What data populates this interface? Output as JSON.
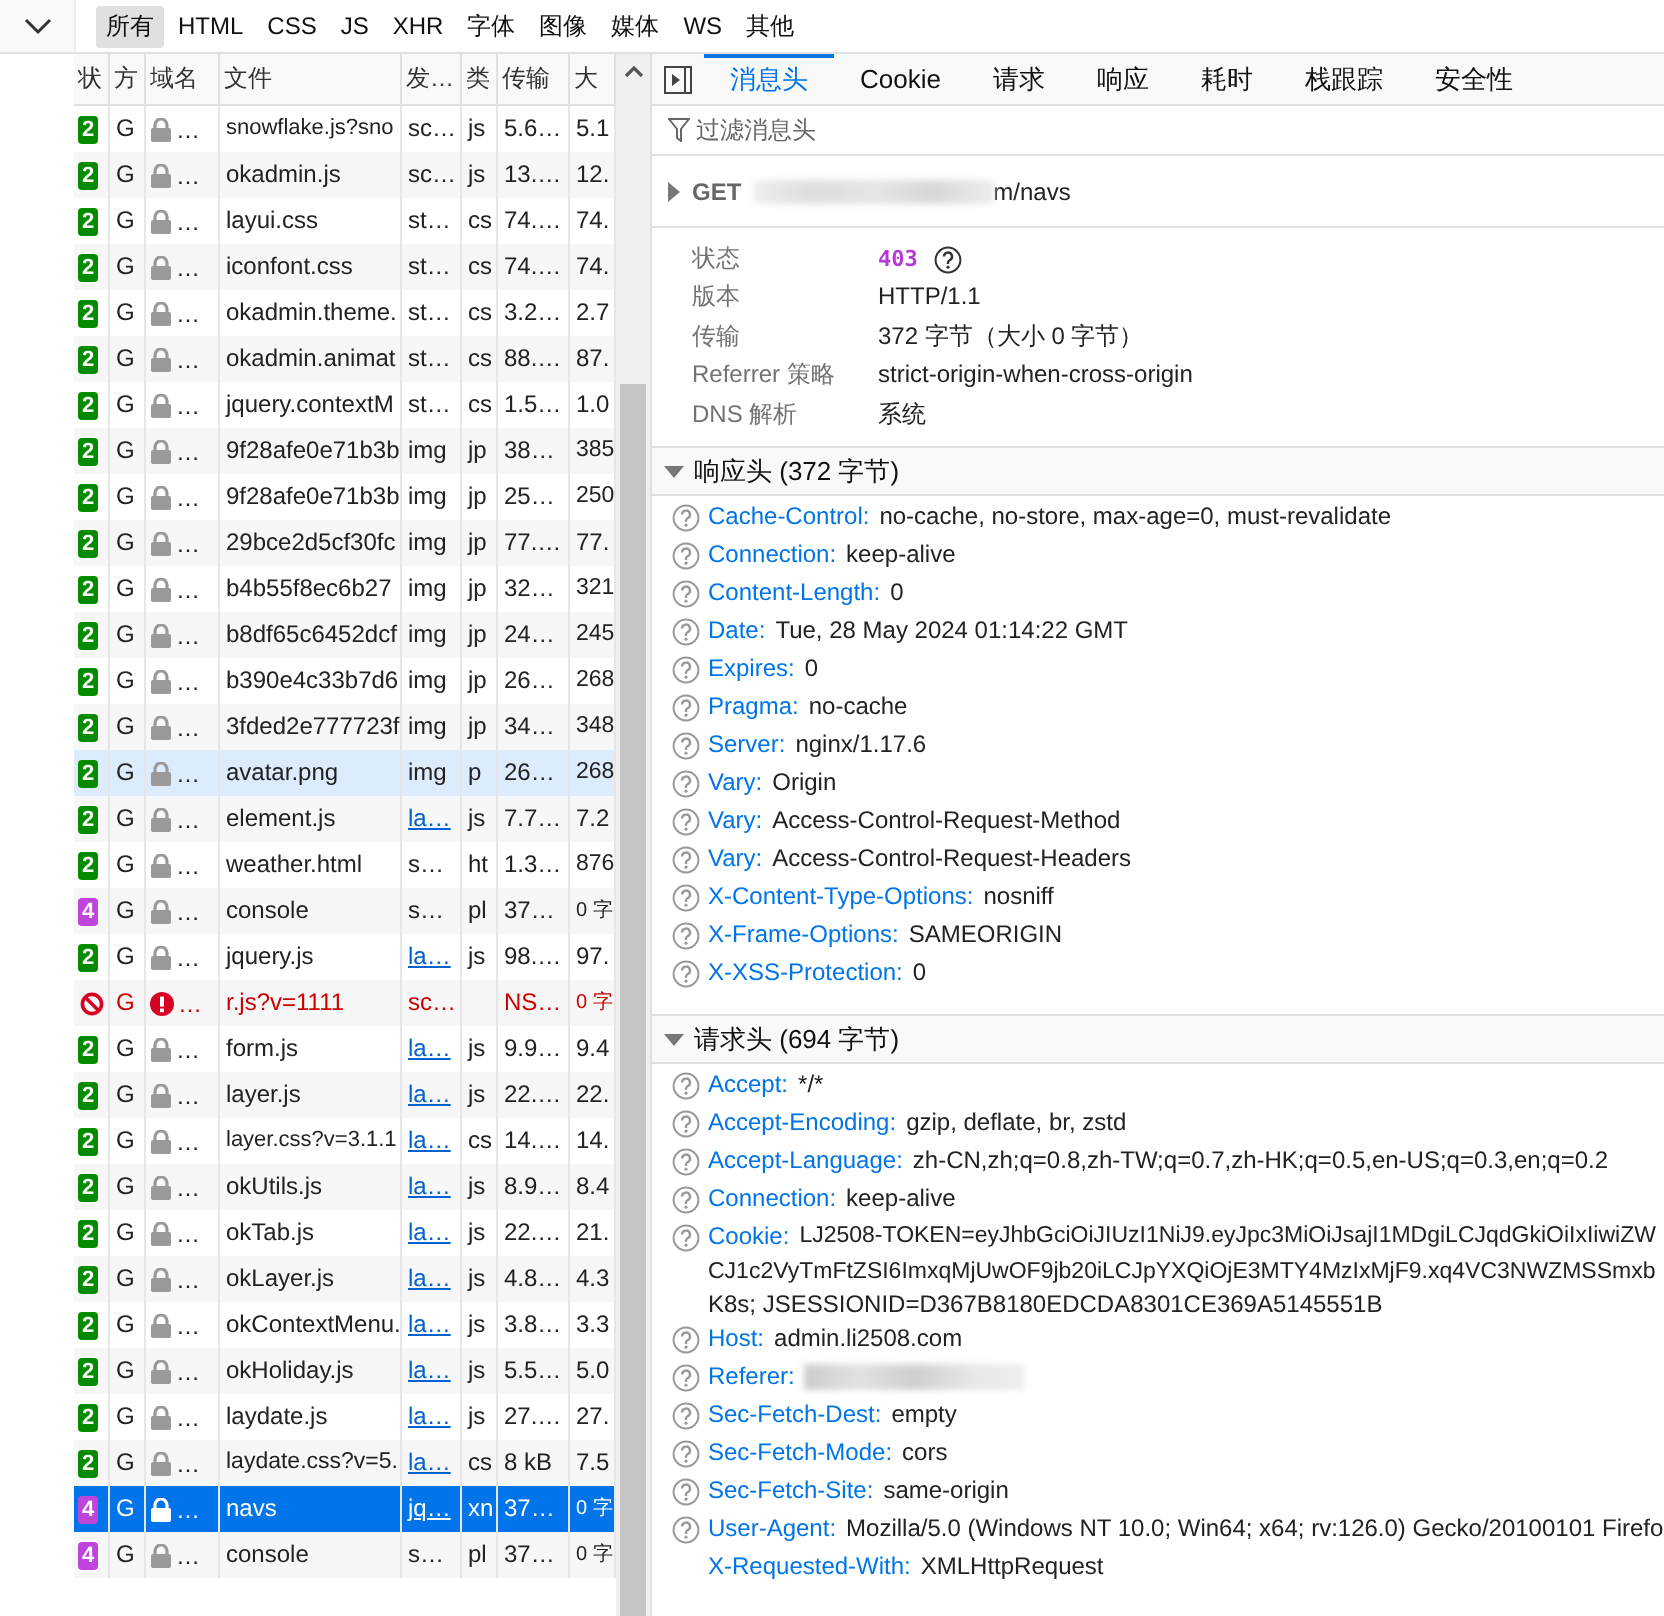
{
  "toolbar": {
    "filters": [
      {
        "label": "所有",
        "selected": true
      },
      {
        "label": "HTML",
        "selected": false
      },
      {
        "label": "CSS",
        "selected": false
      },
      {
        "label": "JS",
        "selected": false
      },
      {
        "label": "XHR",
        "selected": false
      },
      {
        "label": "字体",
        "selected": false
      },
      {
        "label": "图像",
        "selected": false
      },
      {
        "label": "媒体",
        "selected": false
      },
      {
        "label": "WS",
        "selected": false
      },
      {
        "label": "其他",
        "selected": false
      }
    ]
  },
  "table": {
    "columns": [
      "状",
      "方",
      "域名",
      "文件",
      "发…",
      "类",
      "传输",
      "大"
    ],
    "rows": [
      {
        "kind": "ok",
        "status": "2",
        "color": "#058b00",
        "method": "G",
        "domain": "…",
        "file": "snowflake.js?sno",
        "initiator": "sc…",
        "initiator_link": false,
        "type": "js",
        "transfer": "5.6…",
        "size": "5.1",
        "selected": false,
        "hovered": false
      },
      {
        "kind": "ok",
        "status": "2",
        "color": "#058b00",
        "method": "G",
        "domain": "…",
        "file": "okadmin.js",
        "initiator": "sc…",
        "initiator_link": false,
        "type": "js",
        "transfer": "13.…",
        "size": "12.",
        "selected": false,
        "hovered": false
      },
      {
        "kind": "ok",
        "status": "2",
        "color": "#058b00",
        "method": "G",
        "domain": "…",
        "file": "layui.css",
        "initiator": "st…",
        "initiator_link": false,
        "type": "cs",
        "transfer": "74.…",
        "size": "74.",
        "selected": false,
        "hovered": false
      },
      {
        "kind": "ok",
        "status": "2",
        "color": "#058b00",
        "method": "G",
        "domain": "…",
        "file": "iconfont.css",
        "initiator": "st…",
        "initiator_link": false,
        "type": "cs",
        "transfer": "74.…",
        "size": "74.",
        "selected": false,
        "hovered": false
      },
      {
        "kind": "ok",
        "status": "2",
        "color": "#058b00",
        "method": "G",
        "domain": "…",
        "file": "okadmin.theme.",
        "initiator": "st…",
        "initiator_link": false,
        "type": "cs",
        "transfer": "3.2…",
        "size": "2.7",
        "selected": false,
        "hovered": false
      },
      {
        "kind": "ok",
        "status": "2",
        "color": "#058b00",
        "method": "G",
        "domain": "…",
        "file": "okadmin.animat",
        "initiator": "st…",
        "initiator_link": false,
        "type": "cs",
        "transfer": "88.…",
        "size": "87.",
        "selected": false,
        "hovered": false
      },
      {
        "kind": "ok",
        "status": "2",
        "color": "#058b00",
        "method": "G",
        "domain": "…",
        "file": "jquery.contextM",
        "initiator": "st…",
        "initiator_link": false,
        "type": "cs",
        "transfer": "1.5…",
        "size": "1.0",
        "selected": false,
        "hovered": false
      },
      {
        "kind": "ok",
        "status": "2",
        "color": "#058b00",
        "method": "G",
        "domain": "…",
        "file": "9f28afe0e71b3b",
        "initiator": "img",
        "initiator_link": false,
        "type": "jp",
        "transfer": "38…",
        "size": "385",
        "selected": false,
        "hovered": false
      },
      {
        "kind": "ok",
        "status": "2",
        "color": "#058b00",
        "method": "G",
        "domain": "…",
        "file": "9f28afe0e71b3b",
        "initiator": "img",
        "initiator_link": false,
        "type": "jp",
        "transfer": "25…",
        "size": "250",
        "selected": false,
        "hovered": false
      },
      {
        "kind": "ok",
        "status": "2",
        "color": "#058b00",
        "method": "G",
        "domain": "…",
        "file": "29bce2d5cf30fc",
        "initiator": "img",
        "initiator_link": false,
        "type": "jp",
        "transfer": "77.…",
        "size": "77.",
        "selected": false,
        "hovered": false
      },
      {
        "kind": "ok",
        "status": "2",
        "color": "#058b00",
        "method": "G",
        "domain": "…",
        "file": "b4b55f8ec6b27",
        "initiator": "img",
        "initiator_link": false,
        "type": "jp",
        "transfer": "32…",
        "size": "321",
        "selected": false,
        "hovered": false
      },
      {
        "kind": "ok",
        "status": "2",
        "color": "#058b00",
        "method": "G",
        "domain": "…",
        "file": "b8df65c6452dcf",
        "initiator": "img",
        "initiator_link": false,
        "type": "jp",
        "transfer": "24…",
        "size": "245",
        "selected": false,
        "hovered": false
      },
      {
        "kind": "ok",
        "status": "2",
        "color": "#058b00",
        "method": "G",
        "domain": "…",
        "file": "b390e4c33b7d6",
        "initiator": "img",
        "initiator_link": false,
        "type": "jp",
        "transfer": "26…",
        "size": "268",
        "selected": false,
        "hovered": false
      },
      {
        "kind": "ok",
        "status": "2",
        "color": "#058b00",
        "method": "G",
        "domain": "…",
        "file": "3fded2e777723f",
        "initiator": "img",
        "initiator_link": false,
        "type": "jp",
        "transfer": "34…",
        "size": "348",
        "selected": false,
        "hovered": false
      },
      {
        "kind": "ok",
        "status": "2",
        "color": "#058b00",
        "method": "G",
        "domain": "…",
        "file": "avatar.png",
        "initiator": "img",
        "initiator_link": false,
        "type": "p",
        "transfer": "26…",
        "size": "268",
        "selected": false,
        "hovered": true
      },
      {
        "kind": "ok",
        "status": "2",
        "color": "#058b00",
        "method": "G",
        "domain": "…",
        "file": "element.js",
        "initiator": "la…",
        "initiator_link": true,
        "type": "js",
        "transfer": "7.7…",
        "size": "7.2",
        "selected": false,
        "hovered": false
      },
      {
        "kind": "ok",
        "status": "2",
        "color": "#058b00",
        "method": "G",
        "domain": "…",
        "file": "weather.html",
        "initiator": "s…",
        "initiator_link": false,
        "type": "ht",
        "transfer": "1.3…",
        "size": "876",
        "selected": false,
        "hovered": false
      },
      {
        "kind": "ok",
        "status": "4",
        "color": "#bf44db",
        "method": "G",
        "domain": "…",
        "file": "console",
        "initiator": "s…",
        "initiator_link": false,
        "type": "pl",
        "transfer": "37…",
        "size": "0 字",
        "selected": false,
        "hovered": false
      },
      {
        "kind": "ok",
        "status": "2",
        "color": "#058b00",
        "method": "G",
        "domain": "…",
        "file": "jquery.js",
        "initiator": "la…",
        "initiator_link": true,
        "type": "js",
        "transfer": "98.…",
        "size": "97.",
        "selected": false,
        "hovered": false
      },
      {
        "kind": "blocked",
        "method": "G",
        "domain": "…",
        "file": "r.js?v=1111",
        "initiator": "sc…",
        "initiator_link": false,
        "transfer": "NS…",
        "size": "0 字",
        "selected": false,
        "hovered": false
      },
      {
        "kind": "ok",
        "status": "2",
        "color": "#058b00",
        "method": "G",
        "domain": "…",
        "file": "form.js",
        "initiator": "la…",
        "initiator_link": true,
        "type": "js",
        "transfer": "9.9…",
        "size": "9.4",
        "selected": false,
        "hovered": false
      },
      {
        "kind": "ok",
        "status": "2",
        "color": "#058b00",
        "method": "G",
        "domain": "…",
        "file": "layer.js",
        "initiator": "la…",
        "initiator_link": true,
        "type": "js",
        "transfer": "22.…",
        "size": "22.",
        "selected": false,
        "hovered": false
      },
      {
        "kind": "ok",
        "status": "2",
        "color": "#058b00",
        "method": "G",
        "domain": "…",
        "file": "layer.css?v=3.1.1",
        "initiator": "la…",
        "initiator_link": true,
        "type": "cs",
        "transfer": "14.…",
        "size": "14.",
        "selected": false,
        "hovered": false
      },
      {
        "kind": "ok",
        "status": "2",
        "color": "#058b00",
        "method": "G",
        "domain": "…",
        "file": "okUtils.js",
        "initiator": "la…",
        "initiator_link": true,
        "type": "js",
        "transfer": "8.9…",
        "size": "8.4",
        "selected": false,
        "hovered": false
      },
      {
        "kind": "ok",
        "status": "2",
        "color": "#058b00",
        "method": "G",
        "domain": "…",
        "file": "okTab.js",
        "initiator": "la…",
        "initiator_link": true,
        "type": "js",
        "transfer": "22.…",
        "size": "21.",
        "selected": false,
        "hovered": false
      },
      {
        "kind": "ok",
        "status": "2",
        "color": "#058b00",
        "method": "G",
        "domain": "…",
        "file": "okLayer.js",
        "initiator": "la…",
        "initiator_link": true,
        "type": "js",
        "transfer": "4.8…",
        "size": "4.3",
        "selected": false,
        "hovered": false
      },
      {
        "kind": "ok",
        "status": "2",
        "color": "#058b00",
        "method": "G",
        "domain": "…",
        "file": "okContextMenu.",
        "initiator": "la…",
        "initiator_link": true,
        "type": "js",
        "transfer": "3.8…",
        "size": "3.3",
        "selected": false,
        "hovered": false
      },
      {
        "kind": "ok",
        "status": "2",
        "color": "#058b00",
        "method": "G",
        "domain": "…",
        "file": "okHoliday.js",
        "initiator": "la…",
        "initiator_link": true,
        "type": "js",
        "transfer": "5.5…",
        "size": "5.0",
        "selected": false,
        "hovered": false
      },
      {
        "kind": "ok",
        "status": "2",
        "color": "#058b00",
        "method": "G",
        "domain": "…",
        "file": "laydate.js",
        "initiator": "la…",
        "initiator_link": true,
        "type": "js",
        "transfer": "27.…",
        "size": "27.",
        "selected": false,
        "hovered": false
      },
      {
        "kind": "ok",
        "status": "2",
        "color": "#058b00",
        "method": "G",
        "domain": "…",
        "file": "laydate.css?v=5.",
        "initiator": "la…",
        "initiator_link": true,
        "type": "cs",
        "transfer": "8 kB",
        "size": "7.5",
        "selected": false,
        "hovered": false
      },
      {
        "kind": "ok",
        "status": "4",
        "color": "#bf44db",
        "method": "G",
        "domain": "…",
        "file": "navs",
        "initiator": "jq…",
        "initiator_link": true,
        "type": "xn",
        "transfer": "37…",
        "size": "0 字",
        "selected": true,
        "hovered": false
      },
      {
        "kind": "ok",
        "status": "4",
        "color": "#bf44db",
        "method": "G",
        "domain": "…",
        "file": "console",
        "initiator": "s…",
        "initiator_link": false,
        "type": "pl",
        "transfer": "37…",
        "size": "0 字",
        "selected": false,
        "hovered": false
      }
    ]
  },
  "details": {
    "tabs": [
      {
        "label": "消息头",
        "selected": true
      },
      {
        "label": "Cookie",
        "selected": false
      },
      {
        "label": "请求",
        "selected": false
      },
      {
        "label": "响应",
        "selected": false
      },
      {
        "label": "耗时",
        "selected": false
      },
      {
        "label": "栈跟踪",
        "selected": false
      },
      {
        "label": "安全性",
        "selected": false
      }
    ],
    "filter": {
      "placeholder": "过滤消息头"
    },
    "request_line": {
      "method": "GET",
      "url": "m/navs",
      "redacted": true
    },
    "summary": [
      {
        "kind": "status",
        "label": "状态",
        "value": "403"
      },
      {
        "kind": "text",
        "label": "版本",
        "value": "HTTP/1.1"
      },
      {
        "kind": "text",
        "label": "传输",
        "value": "372 字节（大小 0 字节）"
      },
      {
        "kind": "text",
        "label": "Referrer 策略",
        "value": "strict-origin-when-cross-origin"
      },
      {
        "kind": "text",
        "label": "DNS 解析",
        "value": "系统"
      }
    ],
    "sections": [
      {
        "title": "响应头 (372 字节)",
        "expanded": true,
        "headers": [
          {
            "name": "Cache-Control:",
            "value": "no-cache, no-store, max-age=0, must-revalidate",
            "help": true,
            "redacted": false
          },
          {
            "name": "Connection:",
            "value": "keep-alive",
            "help": true,
            "redacted": false
          },
          {
            "name": "Content-Length:",
            "value": "0",
            "help": true,
            "redacted": false
          },
          {
            "name": "Date:",
            "value": "Tue, 28 May 2024 01:14:22 GMT",
            "help": true,
            "redacted": false
          },
          {
            "name": "Expires:",
            "value": "0",
            "help": true,
            "redacted": false
          },
          {
            "name": "Pragma:",
            "value": "no-cache",
            "help": true,
            "redacted": false
          },
          {
            "name": "Server:",
            "value": "nginx/1.17.6",
            "help": true,
            "redacted": false
          },
          {
            "name": "Vary:",
            "value": "Origin",
            "help": true,
            "redacted": false
          },
          {
            "name": "Vary:",
            "value": "Access-Control-Request-Method",
            "help": true,
            "redacted": false
          },
          {
            "name": "Vary:",
            "value": "Access-Control-Request-Headers",
            "help": true,
            "redacted": false
          },
          {
            "name": "X-Content-Type-Options:",
            "value": "nosniff",
            "help": true,
            "redacted": false
          },
          {
            "name": "X-Frame-Options:",
            "value": "SAMEORIGIN",
            "help": true,
            "redacted": false
          },
          {
            "name": "X-XSS-Protection:",
            "value": "0",
            "help": true,
            "redacted": false
          }
        ]
      },
      {
        "title": "请求头 (694 字节)",
        "expanded": true,
        "headers": [
          {
            "name": "Accept:",
            "value": "*/*",
            "help": true,
            "redacted": false
          },
          {
            "name": "Accept-Encoding:",
            "value": "gzip, deflate, br, zstd",
            "help": true,
            "redacted": false
          },
          {
            "name": "Accept-Language:",
            "value": "zh-CN,zh;q=0.8,zh-TW;q=0.7,zh-HK;q=0.5,en-US;q=0.3,en;q=0.2",
            "help": true,
            "redacted": false
          },
          {
            "name": "Connection:",
            "value": "keep-alive",
            "help": true,
            "redacted": false
          },
          {
            "name": "Cookie:",
            "value_lines": [
              "LJ2508-TOKEN=eyJhbGciOiJIUzI1NiJ9.eyJpc3MiOiJsajI1MDgiLCJqdGkiOiIxIiwiZW",
              "CJ1c2VyTmFtZSI6ImxqMjUwOF9jb20iLCJpYXQiOjE3MTY4MzIxMjF9.xq4VC3NWZMSSmxb",
              "K8s; JSESSIONID=D367B8180EDCDA8301CE369A5145551B"
            ],
            "help": true,
            "redacted": false
          },
          {
            "name": "Host:",
            "value": "admin.li2508.com",
            "help": true,
            "redacted": false
          },
          {
            "name": "Referer:",
            "help": true,
            "redacted": true
          },
          {
            "name": "Sec-Fetch-Dest:",
            "value": "empty",
            "help": true,
            "redacted": false
          },
          {
            "name": "Sec-Fetch-Mode:",
            "value": "cors",
            "help": true,
            "redacted": false
          },
          {
            "name": "Sec-Fetch-Site:",
            "value": "same-origin",
            "help": true,
            "redacted": false
          },
          {
            "name": "User-Agent:",
            "value": "Mozilla/5.0 (Windows NT 10.0; Win64; x64; rv:126.0) Gecko/20100101 Firefo",
            "help": true,
            "redacted": false
          },
          {
            "name": "X-Requested-With:",
            "value": "XMLHttpRequest",
            "help": false,
            "redacted": false
          }
        ]
      }
    ]
  }
}
